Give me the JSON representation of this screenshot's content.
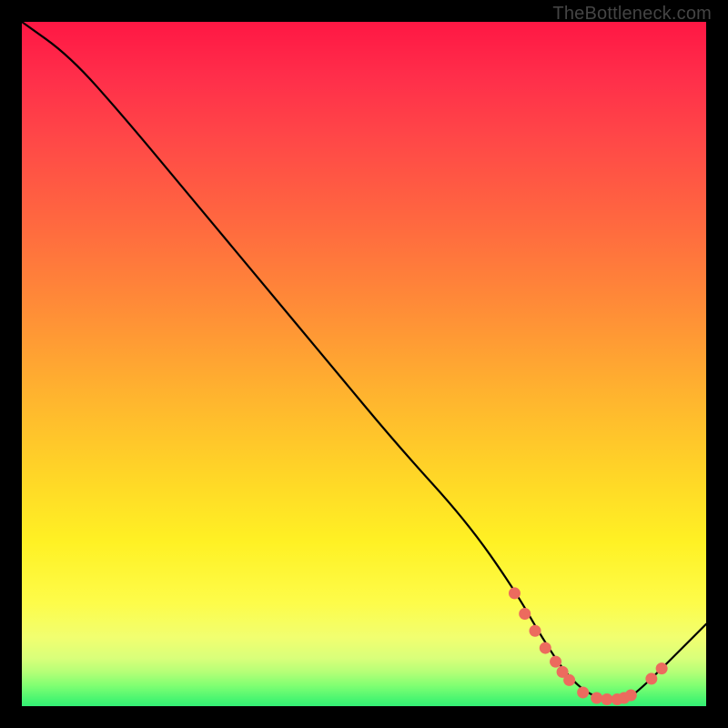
{
  "watermark": "TheBottleneck.com",
  "chart_data": {
    "type": "line",
    "title": "",
    "xlabel": "",
    "ylabel": "",
    "xlim": [
      0,
      100
    ],
    "ylim": [
      0,
      100
    ],
    "series": [
      {
        "name": "curve",
        "x": [
          0,
          7,
          15,
          25,
          35,
          45,
          55,
          65,
          72,
          76,
          80,
          84,
          88,
          90,
          100
        ],
        "values": [
          100,
          95,
          86,
          74,
          62,
          50,
          38,
          27,
          17,
          10,
          4,
          1,
          1,
          2,
          12
        ]
      }
    ],
    "markers": {
      "name": "coral-dots",
      "color": "#ec6b5e",
      "x": [
        72.0,
        73.5,
        75.0,
        76.5,
        78.0,
        79.0,
        80.0,
        82.0,
        84.0,
        85.5,
        87.0,
        88.0,
        89.0,
        92.0,
        93.5
      ],
      "values": [
        16.5,
        13.5,
        11.0,
        8.5,
        6.5,
        5.0,
        3.8,
        2.0,
        1.2,
        1.0,
        1.0,
        1.2,
        1.6,
        4.0,
        5.5
      ]
    },
    "background_gradient": [
      "#ff1744",
      "#ff6a3f",
      "#ffd527",
      "#fdfc4a",
      "#49f571"
    ]
  }
}
